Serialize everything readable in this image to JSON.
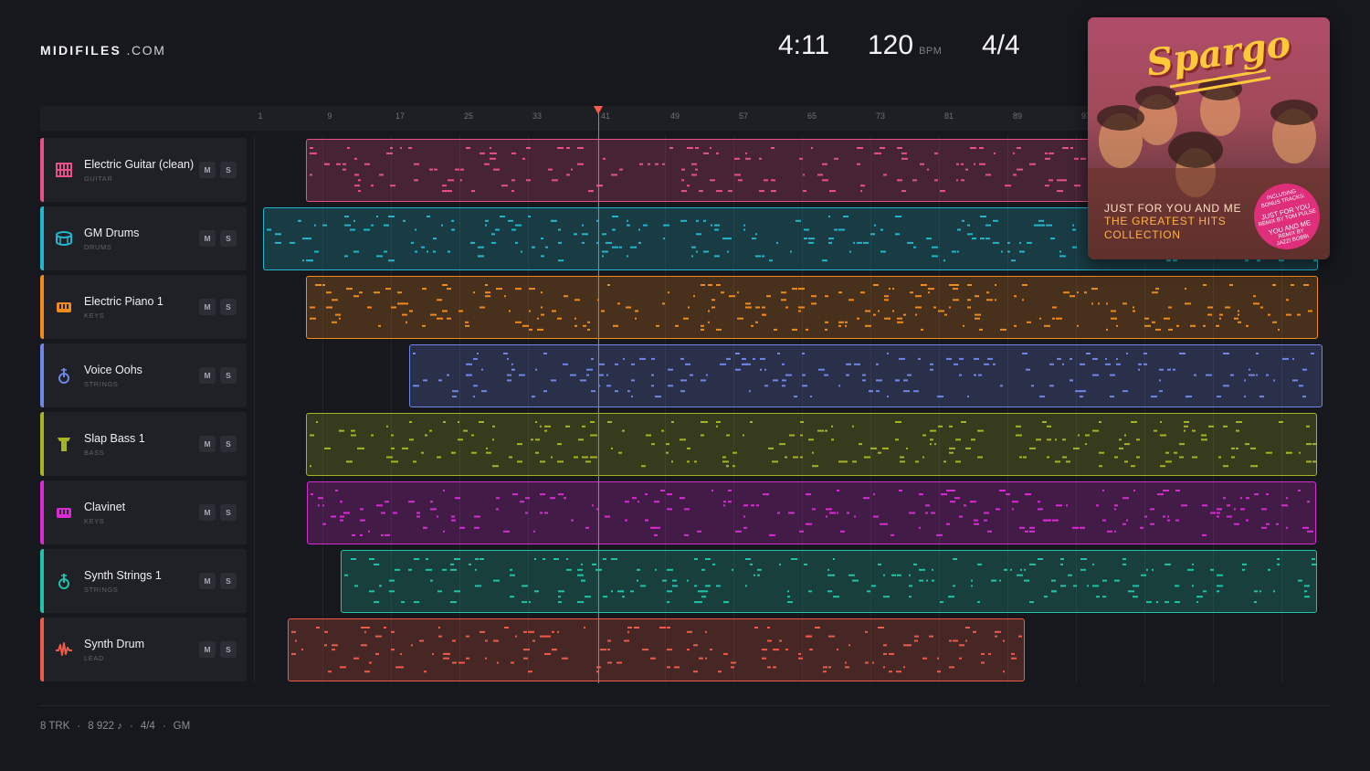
{
  "header": {
    "logo_bold": "MIDIFILES",
    "logo_suffix": " .COM",
    "time": "4:11",
    "tempo": "120",
    "tempo_unit": "BPM",
    "meter": "4/4"
  },
  "ruler": {
    "bars": [
      "1",
      "9",
      "17",
      "25",
      "33",
      "41",
      "49",
      "57",
      "65",
      "73",
      "81",
      "89",
      "97"
    ]
  },
  "tracks": [
    {
      "name": "Electric Guitar (clean)",
      "category": "GUITAR",
      "icon": "guitar-icon",
      "color": "#e8508a",
      "mute": "M",
      "solo": "S"
    },
    {
      "name": "GM Drums",
      "category": "DRUMS",
      "icon": "drum-icon",
      "color": "#22b6cc",
      "mute": "M",
      "solo": "S"
    },
    {
      "name": "Electric Piano 1",
      "category": "KEYS",
      "icon": "piano-icon",
      "color": "#f08a1c",
      "mute": "M",
      "solo": "S"
    },
    {
      "name": "Voice Oohs",
      "category": "STRINGS",
      "icon": "violin-icon",
      "color": "#6f86e6",
      "mute": "M",
      "solo": "S"
    },
    {
      "name": "Slap Bass 1",
      "category": "BASS",
      "icon": "bass-icon",
      "color": "#a6b322",
      "mute": "M",
      "solo": "S"
    },
    {
      "name": "Clavinet",
      "category": "KEYS",
      "icon": "keys-icon",
      "color": "#d92ad4",
      "mute": "M",
      "solo": "S"
    },
    {
      "name": "Synth Strings 1",
      "category": "STRINGS",
      "icon": "violin-icon",
      "color": "#1fc4a8",
      "mute": "M",
      "solo": "S"
    },
    {
      "name": "Synth Drum",
      "category": "LEAD",
      "icon": "waveform-icon",
      "color": "#ef5a48",
      "mute": "M",
      "solo": "S"
    }
  ],
  "album": {
    "band": "Spargo",
    "line1": "JUST FOR YOU AND ME",
    "line2": "THE GREATEST HITS",
    "line3": "COLLECTION",
    "badge": [
      "INCLUDING",
      "BONUS TRACKS:",
      "JUST FOR YOU",
      "REMIX BY TOM PULSE",
      "YOU AND ME",
      "REMIX BY",
      "JAZZI BOBBI"
    ]
  },
  "footer": {
    "tracks": "8 TRK",
    "notes": "8 922 ♪",
    "meter": "4/4",
    "standard": "GM",
    "sep": "·"
  },
  "colors": {
    "background": "#17181d",
    "playhead": "#ff5a4a",
    "album_title": "#ffc93a",
    "album_line1": "#ffe2c4",
    "album_lines": "#ffb347",
    "badge": "#e02f7a"
  }
}
